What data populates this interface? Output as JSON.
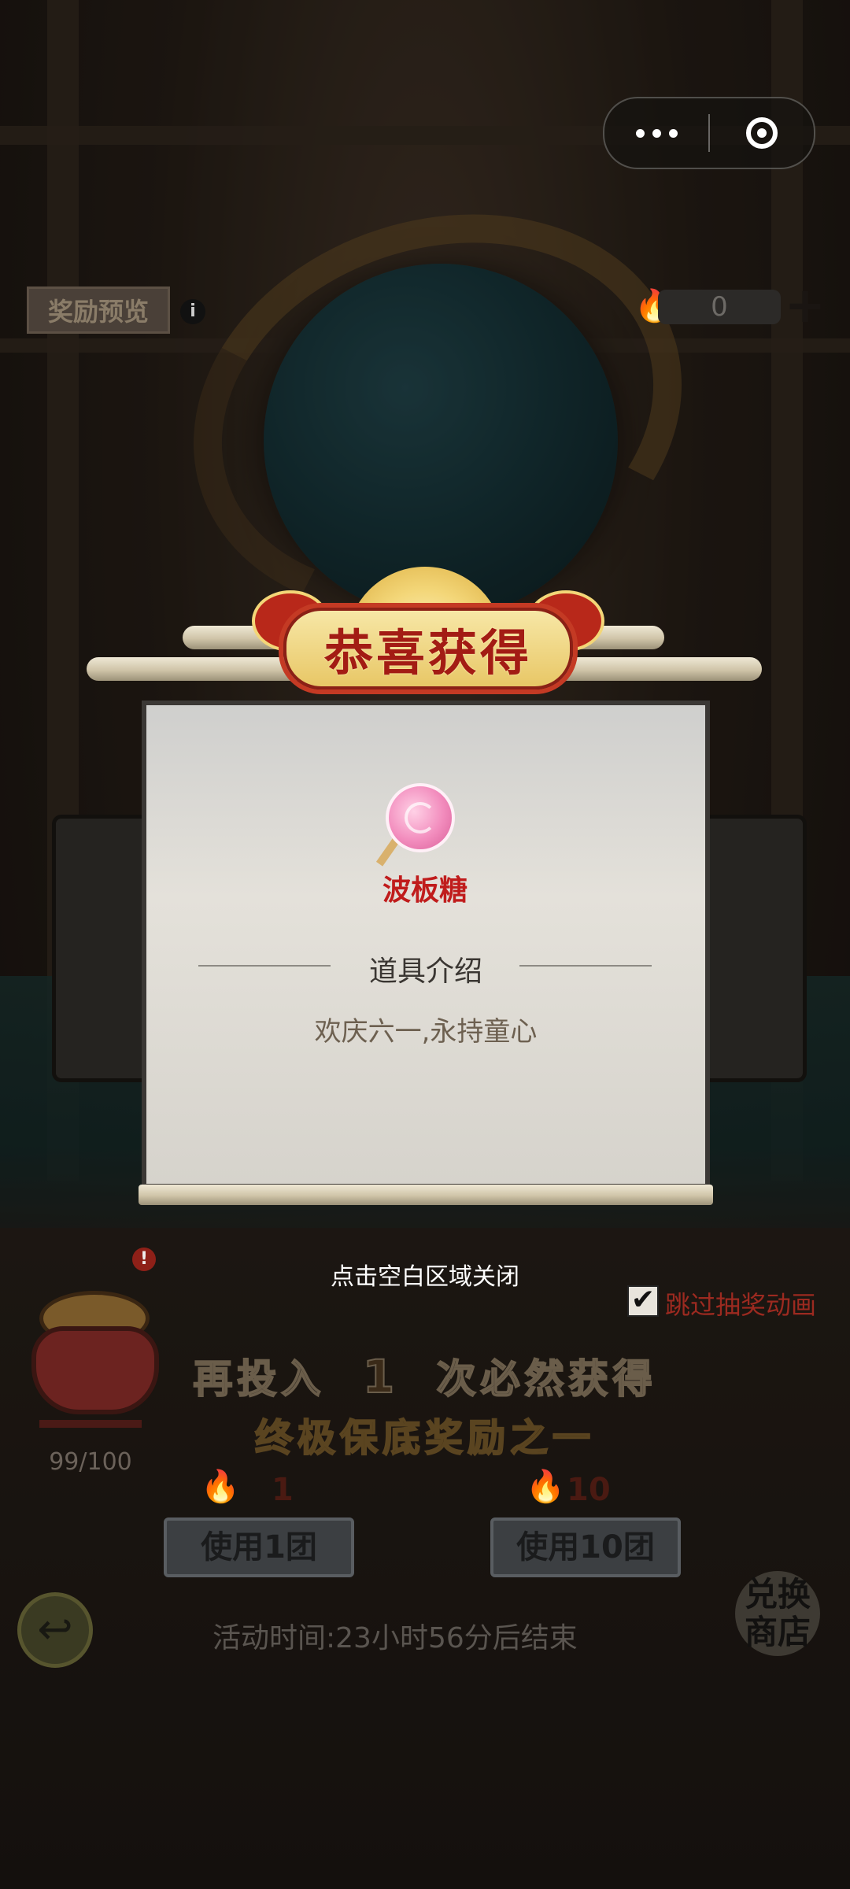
{
  "topbar": {
    "more_icon": "more-dots-icon",
    "target_icon": "target-icon"
  },
  "header": {
    "reward_preview_label": "奖励预览",
    "info_icon": "info-icon",
    "currency_icon": "flame-icon",
    "currency_value": "0",
    "add_icon": "plus-icon"
  },
  "modal": {
    "title": "恭喜获得",
    "item_icon": "lollipop-icon",
    "item_name": "波板糖",
    "section_title": "道具介绍",
    "description": "欢庆六一,永持童心",
    "close_hint": "点击空白区域关闭",
    "colors": {
      "item_name": "#c01c1c",
      "title": "#a31c14"
    }
  },
  "skip": {
    "label": "跳过抽奖动画",
    "checked": true
  },
  "pity": {
    "badge": "!",
    "progress_text": "99/100",
    "line1_prefix": "再投入",
    "line1_number": "1",
    "line1_suffix": "次必然获得",
    "line2": "终极保底奖励之一"
  },
  "draw_buttons": [
    {
      "cost": "1",
      "label": "使用1团"
    },
    {
      "cost": "10",
      "label": "使用10团"
    }
  ],
  "footer": {
    "back_icon": "back-arrow-icon",
    "event_time": "活动时间:23小时56分后结束",
    "shop_label": "兑换商店"
  }
}
